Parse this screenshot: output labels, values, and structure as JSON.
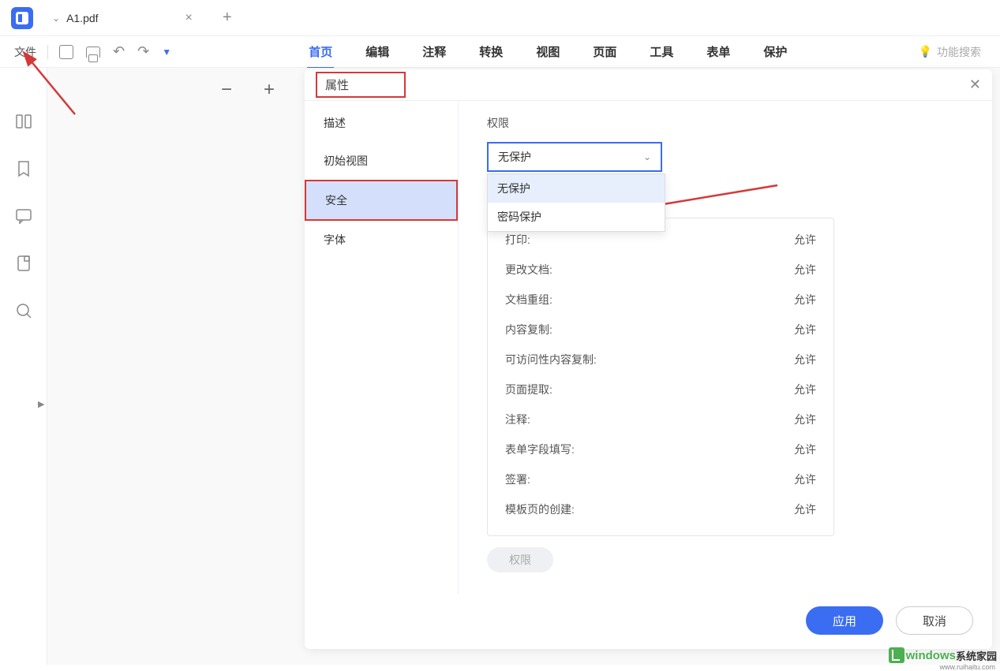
{
  "tab": {
    "name": "A1.pdf"
  },
  "toolbar": {
    "file": "文件"
  },
  "menus": {
    "home": "首页",
    "edit": "编辑",
    "annotate": "注释",
    "convert": "转换",
    "view": "视图",
    "page": "页面",
    "tools": "工具",
    "form": "表单",
    "protect": "保护"
  },
  "feature_search": "功能搜索",
  "props": {
    "title": "属性",
    "nav": {
      "desc": "描述",
      "initview": "初始视图",
      "security": "安全",
      "font": "字体"
    },
    "permissions_label": "权限",
    "protection_select": {
      "value": "无保护",
      "options": {
        "none": "无保护",
        "password": "密码保护"
      }
    },
    "rows": {
      "print": {
        "label": "打印:",
        "val": "允许"
      },
      "modify": {
        "label": "更改文档:",
        "val": "允许"
      },
      "assemble": {
        "label": "文档重组:",
        "val": "允许"
      },
      "copy": {
        "label": "内容复制:",
        "val": "允许"
      },
      "copy_access": {
        "label": "可访问性内容复制:",
        "val": "允许"
      },
      "extract": {
        "label": "页面提取:",
        "val": "允许"
      },
      "comment": {
        "label": "注释:",
        "val": "允许"
      },
      "form_fill": {
        "label": "表单字段填写:",
        "val": "允许"
      },
      "sign": {
        "label": "签署:",
        "val": "允许"
      },
      "template": {
        "label": "模板页的创建:",
        "val": "允许"
      }
    },
    "perm_btn": "权限",
    "apply": "应用",
    "cancel": "取消"
  },
  "watermark": {
    "brand": "windows",
    "suffix": "系统家园",
    "url": "www.ruihaitu.com"
  }
}
